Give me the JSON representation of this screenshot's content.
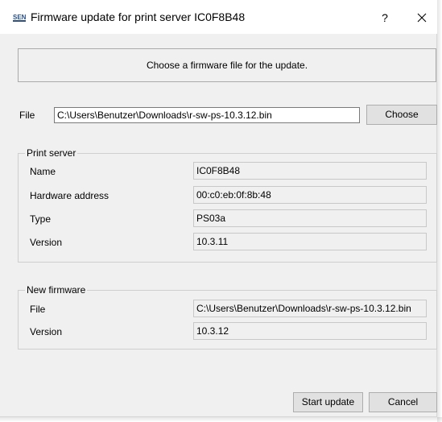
{
  "window": {
    "title": "Firmware update for print server IC0F8B48",
    "help_label": "?",
    "icon": "sen-app-icon",
    "close_icon": "close-icon"
  },
  "banner": {
    "text": "Choose a firmware file for the update."
  },
  "file": {
    "label": "File",
    "value": "C:\\Users\\Benutzer\\Downloads\\r-sw-ps-10.3.12.bin",
    "choose_label": "Choose"
  },
  "print_server": {
    "legend": "Print server",
    "rows": [
      {
        "label": "Name",
        "value": "IC0F8B48"
      },
      {
        "label": "Hardware address",
        "value": "00:c0:eb:0f:8b:48"
      },
      {
        "label": "Type",
        "value": "PS03a"
      },
      {
        "label": "Version",
        "value": "10.3.11"
      }
    ]
  },
  "new_firmware": {
    "legend": "New firmware",
    "rows": [
      {
        "label": "File",
        "value": "C:\\Users\\Benutzer\\Downloads\\r-sw-ps-10.3.12.bin"
      },
      {
        "label": "Version",
        "value": "10.3.12"
      }
    ]
  },
  "buttons": {
    "start_update": "Start update",
    "cancel": "Cancel"
  }
}
